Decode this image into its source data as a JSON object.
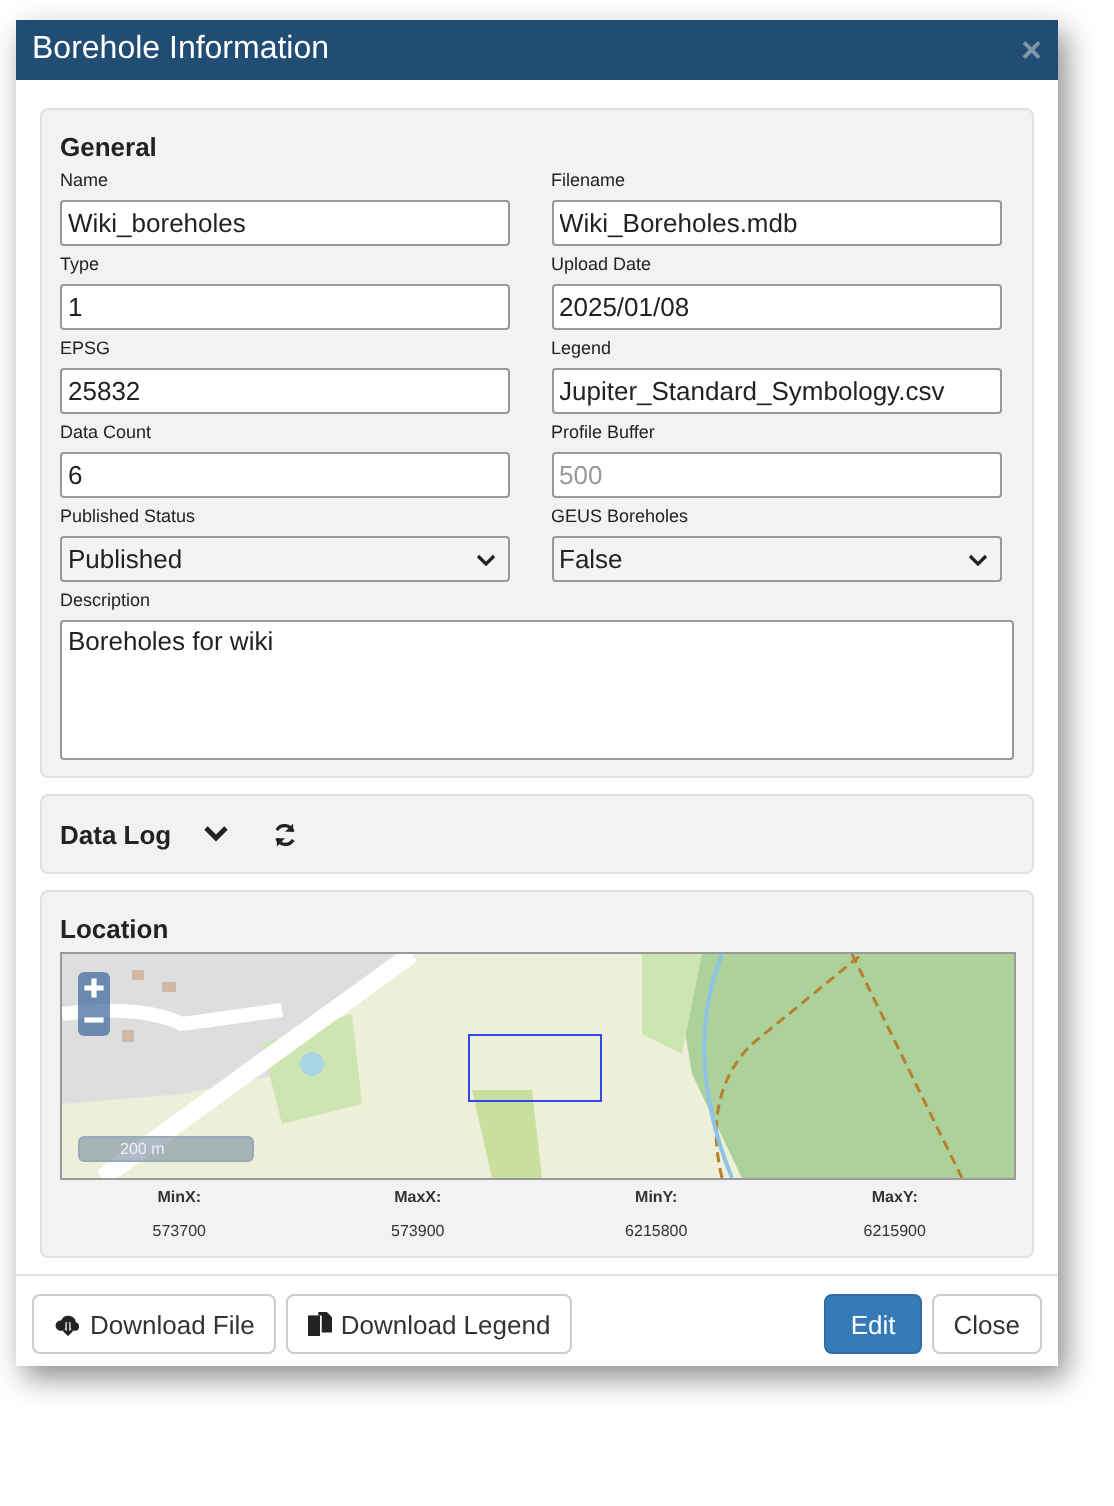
{
  "window": {
    "title": "Borehole Information",
    "close": "×"
  },
  "general": {
    "title": "General",
    "fields": [
      {
        "label": "Name",
        "kind": "input",
        "value": "Wiki_boreholes"
      },
      {
        "label": "Filename",
        "kind": "input",
        "value": "Wiki_Boreholes.mdb"
      },
      {
        "label": "Type",
        "kind": "input",
        "value": "1"
      },
      {
        "label": "Upload Date",
        "kind": "input",
        "value": "2025/01/08"
      },
      {
        "label": "EPSG",
        "kind": "input",
        "value": "25832"
      },
      {
        "label": "Legend",
        "kind": "input",
        "value": "Jupiter_Standard_Symbology.csv"
      },
      {
        "label": "Data Count",
        "kind": "input",
        "value": "6"
      },
      {
        "label": "Profile Buffer",
        "kind": "input",
        "placeholder": "500"
      },
      {
        "label": "Published Status",
        "kind": "select",
        "value": "Published"
      },
      {
        "label": "GEUS Boreholes",
        "kind": "select",
        "value": "False"
      },
      {
        "label": "Description",
        "kind": "textarea",
        "value": "Boreholes for wiki"
      }
    ]
  },
  "data_log": {
    "title": "Data Log",
    "expanded": false
  },
  "location": {
    "title": "Location",
    "map": {
      "scale": "200 m"
    },
    "bounds": [
      {
        "label": "MinX:",
        "value": "573700"
      },
      {
        "label": "MaxX:",
        "value": "573900"
      },
      {
        "label": "MinY:",
        "value": "6215800"
      },
      {
        "label": "MaxY:",
        "value": "6215900"
      }
    ]
  },
  "buttons": [
    {
      "label": "Download File",
      "kind": "download-file"
    },
    {
      "label": "Download Legend",
      "kind": "download-legend"
    },
    {
      "label": "Edit",
      "kind": "primary"
    },
    {
      "label": "Close",
      "kind": "default"
    }
  ]
}
